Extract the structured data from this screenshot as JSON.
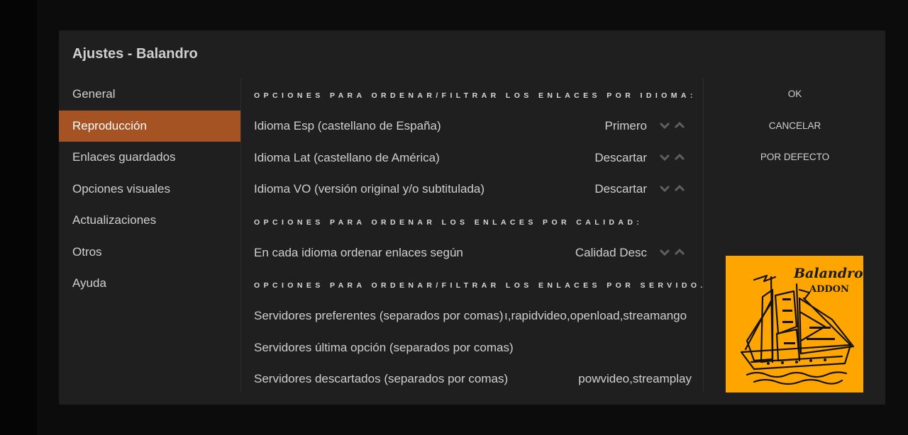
{
  "dialog": {
    "title": "Ajustes - Balandro"
  },
  "categories": [
    {
      "label": "General"
    },
    {
      "label": "Reproducción"
    },
    {
      "label": "Enlaces guardados"
    },
    {
      "label": "Opciones visuales"
    },
    {
      "label": "Actualizaciones"
    },
    {
      "label": "Otros"
    },
    {
      "label": "Ayuda"
    }
  ],
  "active_category": "Reproducción",
  "sections": {
    "idioma": "OPCIONES PARA ORDENAR/FILTRAR LOS ENLACES POR IDIOMA:",
    "calidad": "OPCIONES PARA ORDENAR LOS ENLACES POR CALIDAD:",
    "servidor": "OPCIONES PARA ORDENAR/FILTRAR LOS ENLACES POR SERVIDO..."
  },
  "settings": {
    "esp": {
      "label": "Idioma Esp (castellano de España)",
      "value": "Primero"
    },
    "lat": {
      "label": "Idioma Lat (castellano de América)",
      "value": "Descartar"
    },
    "vo": {
      "label": "Idioma VO (versión original y/o subtitulada)",
      "value": "Descartar"
    },
    "calidad": {
      "label": "En cada idioma ordenar enlaces según",
      "value": "Calidad Desc"
    },
    "preferentes": {
      "label": "Servidores preferentes (separados por comas)",
      "value": "ı,rapidvideo,openload,streamango"
    },
    "ultima": {
      "label": "Servidores última opción (separados por comas)",
      "value": ""
    },
    "descartados": {
      "label": "Servidores descartados (separados por comas)",
      "value": "powvideo,streamplay"
    }
  },
  "actions": {
    "ok": "OK",
    "cancel": "CANCELAR",
    "default": "POR DEFECTO"
  },
  "logo": {
    "line1": "Balandro",
    "line2": "ADDON"
  },
  "colors": {
    "accent": "#a65324",
    "dialog_bg": "#1f1f1f",
    "logo_bg": "#ffa500"
  },
  "icons": {
    "spin_down": "chevron-down-icon",
    "spin_up": "chevron-up-icon"
  }
}
